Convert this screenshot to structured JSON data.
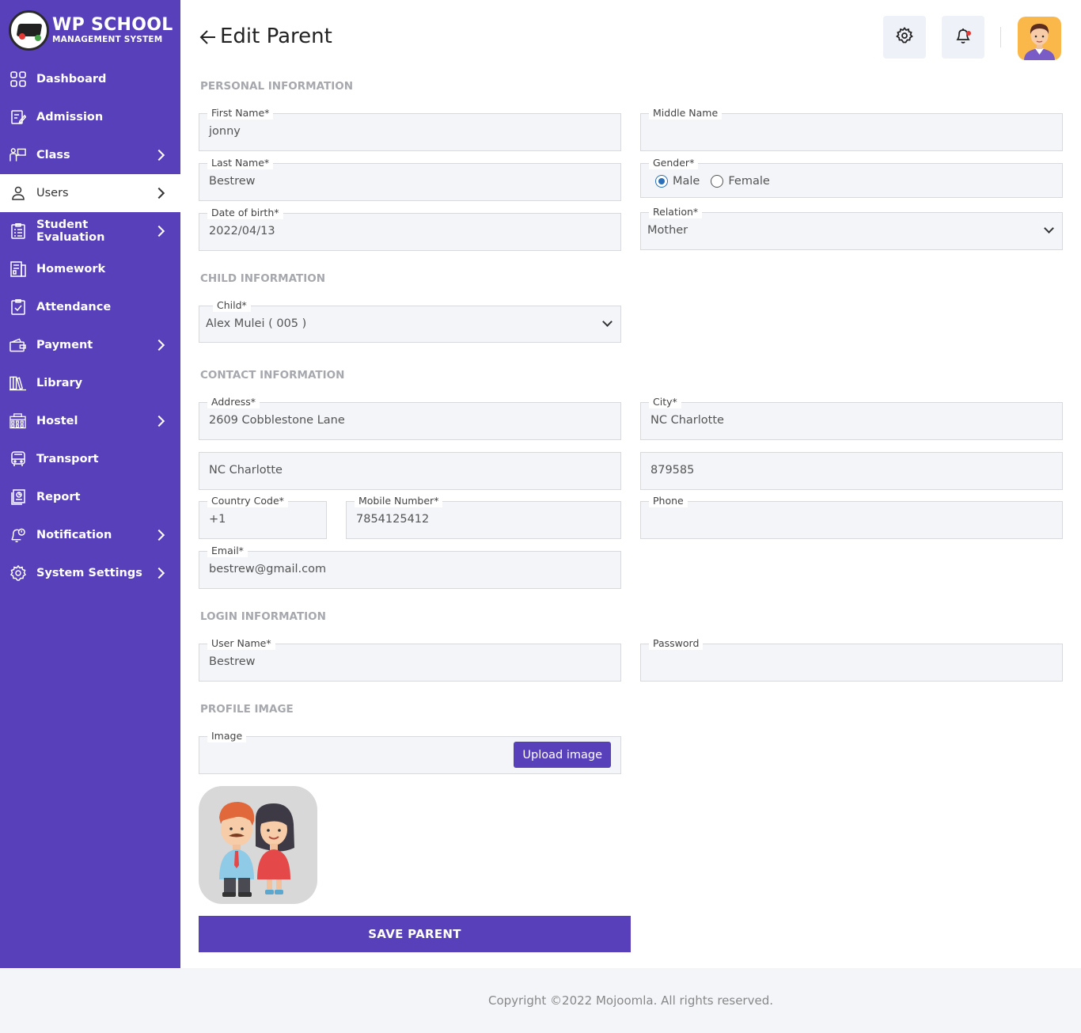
{
  "brand": {
    "title": "WP SCHOOL",
    "subtitle": "MANAGEMENT SYSTEM"
  },
  "sidebar": {
    "items": [
      {
        "label": "Dashboard",
        "icon": "dashboard-icon",
        "has_submenu": false
      },
      {
        "label": "Admission",
        "icon": "admission-icon",
        "has_submenu": false
      },
      {
        "label": "Class",
        "icon": "class-icon",
        "has_submenu": true
      },
      {
        "label": "Users",
        "icon": "user-icon",
        "has_submenu": true,
        "active": true
      },
      {
        "label": "Student Evaluation",
        "icon": "evaluation-icon",
        "has_submenu": true
      },
      {
        "label": "Homework",
        "icon": "homework-icon",
        "has_submenu": false
      },
      {
        "label": "Attendance",
        "icon": "attendance-icon",
        "has_submenu": false
      },
      {
        "label": "Payment",
        "icon": "wallet-icon",
        "has_submenu": true
      },
      {
        "label": "Library",
        "icon": "library-icon",
        "has_submenu": false
      },
      {
        "label": "Hostel",
        "icon": "hostel-icon",
        "has_submenu": true
      },
      {
        "label": "Transport",
        "icon": "bus-icon",
        "has_submenu": false
      },
      {
        "label": "Report",
        "icon": "report-icon",
        "has_submenu": false
      },
      {
        "label": "Notification",
        "icon": "notification-icon",
        "has_submenu": true
      },
      {
        "label": "System Settings",
        "icon": "settings-icon",
        "has_submenu": true
      }
    ]
  },
  "header": {
    "title": "Edit Parent"
  },
  "sections": {
    "personal": "PERSONAL INFORMATION",
    "child": "CHILD INFORMATION",
    "contact": "CONTACT INFORMATION",
    "login": "LOGIN INFORMATION",
    "profile": "PROFILE IMAGE"
  },
  "form": {
    "first_name": {
      "label": "First Name*",
      "value": "jonny"
    },
    "middle_name": {
      "label": "Middle Name",
      "value": ""
    },
    "last_name": {
      "label": "Last Name*",
      "value": "Bestrew"
    },
    "gender": {
      "label": "Gender*",
      "options": [
        "Male",
        "Female"
      ],
      "selected": "Male"
    },
    "dob": {
      "label": "Date of birth*",
      "value": "2022/04/13"
    },
    "relation": {
      "label": "Relation*",
      "value": "Mother"
    },
    "child": {
      "label": "Child*",
      "value": "Alex Mulei ( 005 )"
    },
    "address": {
      "label": "Address*",
      "value": "2609 Cobblestone Lane"
    },
    "city": {
      "label": "City*",
      "value": "NC Charlotte"
    },
    "state": {
      "value": "NC Charlotte"
    },
    "zip": {
      "value": "879585"
    },
    "country_code": {
      "label": "Country Code*",
      "value": "+1"
    },
    "mobile": {
      "label": "Mobile Number*",
      "value": "7854125412"
    },
    "phone": {
      "label": "Phone",
      "value": ""
    },
    "email": {
      "label": "Email*",
      "value": "bestrew@gmail.com"
    },
    "username": {
      "label": "User Name*",
      "value": "Bestrew"
    },
    "password": {
      "label": "Password",
      "value": ""
    },
    "image": {
      "label": "Image",
      "button": "Upload image"
    }
  },
  "save_button": "SAVE PARENT",
  "footer": "Copyright ©2022 Mojoomla. All rights reserved.",
  "colors": {
    "primary": "#5840bb",
    "field_bg": "#f3f5f9",
    "section_title": "#a6a8ae"
  }
}
